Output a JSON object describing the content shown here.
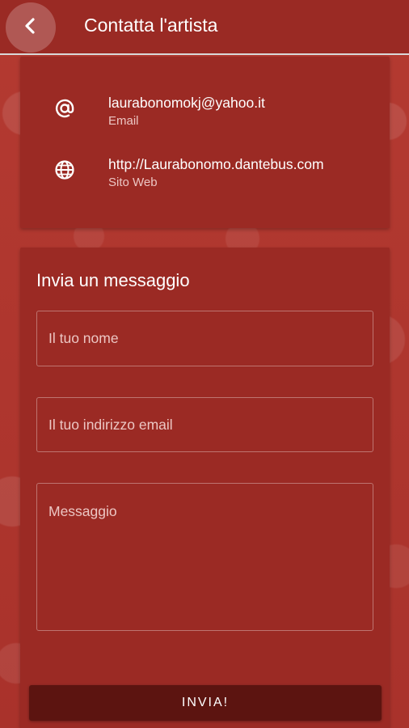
{
  "header": {
    "title": "Contatta l'artista"
  },
  "contacts": [
    {
      "value": "laurabonomokj@yahoo.it",
      "type": "Email",
      "icon": "at-icon"
    },
    {
      "value": "http://Laurabonomo.dantebus.com",
      "type": "Sito Web",
      "icon": "globe-icon"
    }
  ],
  "form": {
    "title": "Invia un messaggio",
    "name_placeholder": "Il tuo nome",
    "email_placeholder": "Il tuo indirizzo email",
    "message_placeholder": "Messaggio",
    "submit_label": "INVIA!"
  },
  "colors": {
    "primary": "#9b2a24",
    "background": "#b0342d",
    "button": "#5c1410"
  }
}
